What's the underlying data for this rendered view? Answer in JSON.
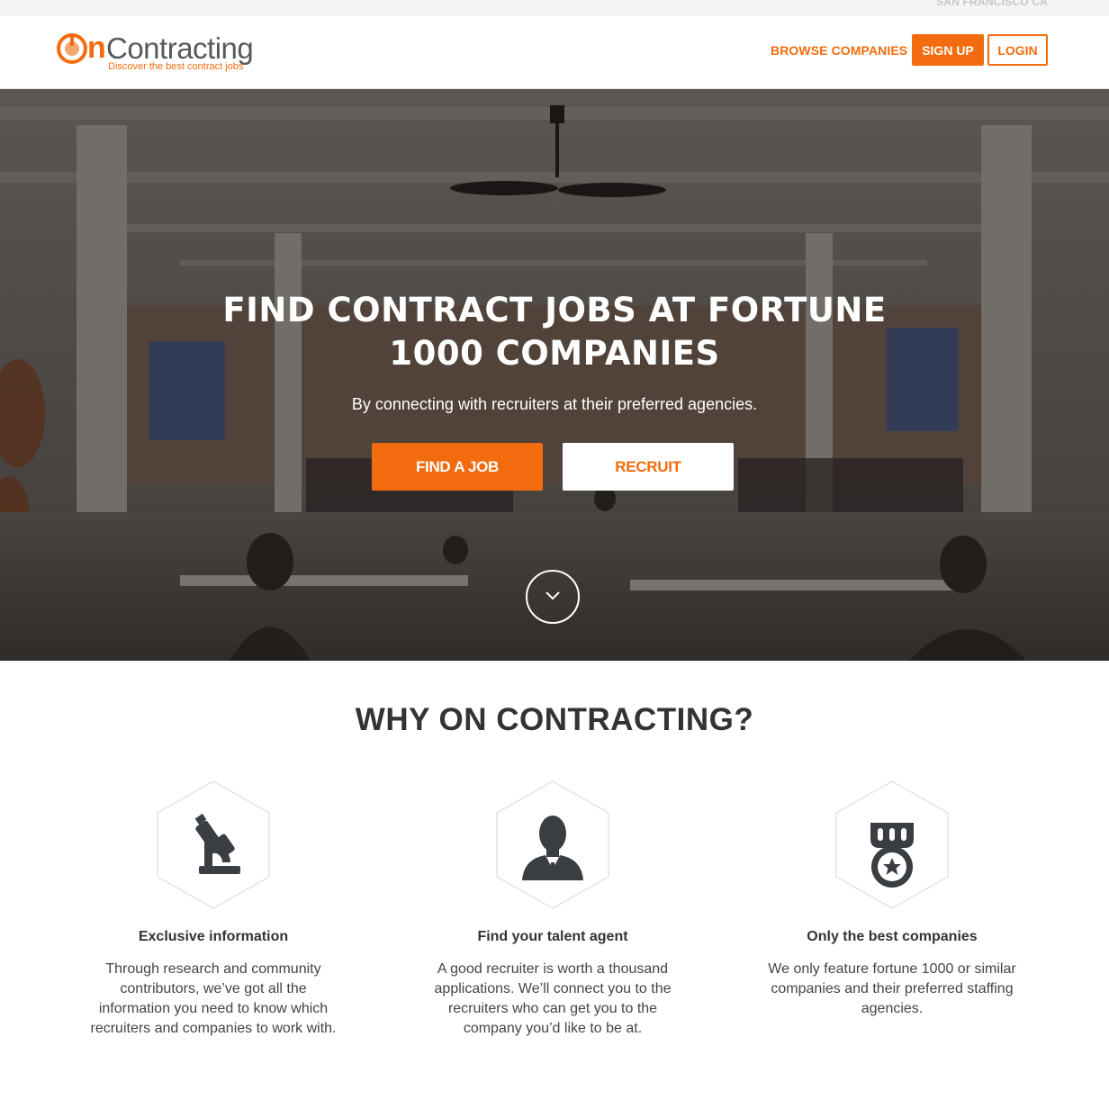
{
  "location": "SAN FRANCISCO CA",
  "logo": {
    "mark": "O",
    "mark_letter": "n",
    "word": "Contracting",
    "tagline": "Discover the best contract jobs"
  },
  "nav": {
    "browse": "BROWSE COMPANIES",
    "signup": "SIGN UP",
    "login": "LOGIN"
  },
  "hero": {
    "title_line1": "FIND CONTRACT JOBS AT FORTUNE",
    "title_line2": "1000 COMPANIES",
    "subtitle": "By connecting with recruiters at their preferred agencies.",
    "find_job": "FIND A JOB",
    "recruit": "RECRUIT",
    "scroll_icon": "chevron-down-icon"
  },
  "why": {
    "title": "WHY ON CONTRACTING?",
    "features": [
      {
        "icon": "microscope-icon",
        "title": "Exclusive information",
        "lines": [
          "Through research and community",
          "contributors, we’ve got all the",
          "information you need to know which",
          "recruiters and companies to work with."
        ]
      },
      {
        "icon": "businessman-icon",
        "title": "Find your talent agent",
        "lines": [
          "A good recruiter is worth a thousand",
          "applications. We’ll connect you to the",
          "recruiters who can get you to the",
          "company you’d like to be at."
        ]
      },
      {
        "icon": "medal-icon",
        "title": "Only the best companies",
        "lines": [
          "We only feature fortune 1000 or similar",
          "companies and their preferred staffing",
          "agencies."
        ]
      }
    ]
  },
  "colors": {
    "accent": "#f26c0f",
    "logo_gray": "#58595b",
    "icon_dark": "#3a3d42"
  }
}
